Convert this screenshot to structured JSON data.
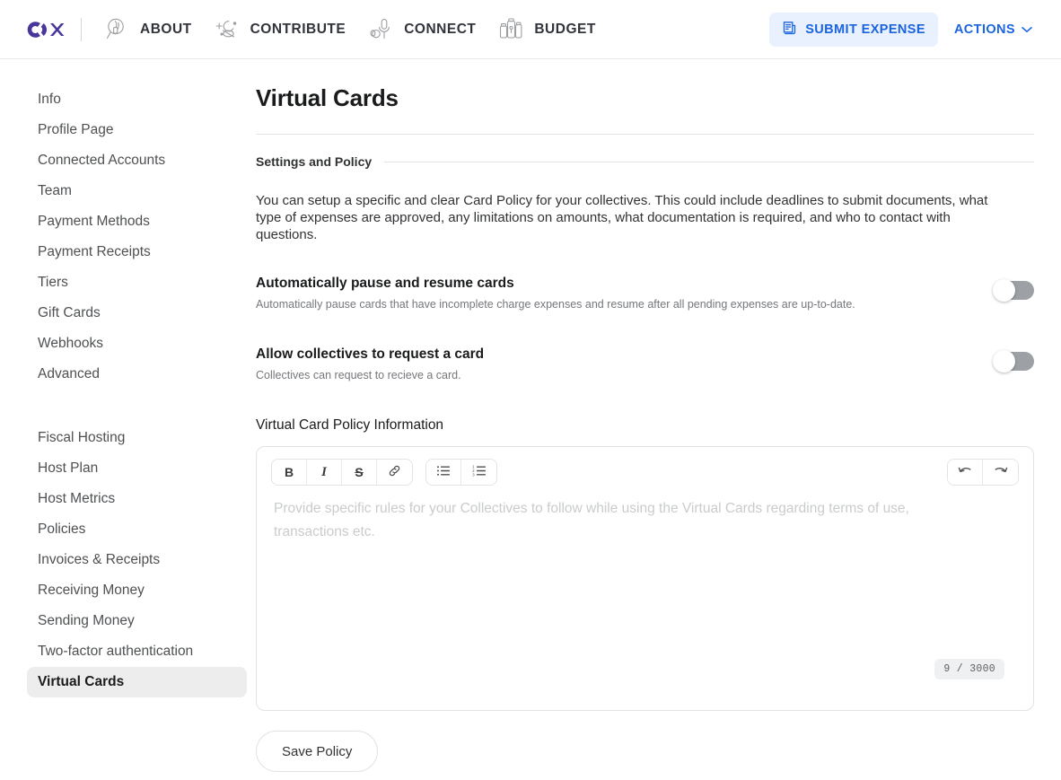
{
  "topbar": {
    "logo_name": "open-collective-logo",
    "brand_color": "#4a359a",
    "nav": [
      {
        "label": "ABOUT",
        "icon": "about-magnifier-icon"
      },
      {
        "label": "CONTRIBUTE",
        "icon": "contribute-stars-icon"
      },
      {
        "label": "CONNECT",
        "icon": "connect-microphone-icon"
      },
      {
        "label": "BUDGET",
        "icon": "budget-jars-icon"
      }
    ],
    "submit_expense": {
      "label": "SUBMIT EXPENSE",
      "icon": "receipt-icon",
      "bg_color": "#e9f1fe",
      "text_color": "#1b64e0"
    },
    "actions": {
      "label": "ACTIONS",
      "icon": "chevron-down-icon",
      "text_color": "#1b64e0"
    }
  },
  "sidebar": {
    "active_item": "Virtual Cards",
    "groups": [
      {
        "items": [
          "Info",
          "Profile Page",
          "Connected Accounts",
          "Team",
          "Payment Methods",
          "Payment Receipts",
          "Tiers",
          "Gift Cards",
          "Webhooks",
          "Advanced"
        ]
      },
      {
        "items": [
          "Fiscal Hosting",
          "Host Plan",
          "Host Metrics",
          "Policies",
          "Invoices & Receipts",
          "Receiving Money",
          "Sending Money",
          "Two-factor authentication",
          "Virtual Cards"
        ]
      }
    ]
  },
  "main": {
    "title": "Virtual Cards",
    "section_label": "Settings and Policy",
    "intro": "You can setup a specific and clear Card Policy for your collectives. This could include deadlines to submit documents, what type of expenses are approved, any limitations on amounts, what documentation is required, and who to contact with questions.",
    "toggles": [
      {
        "title": "Automatically pause and resume cards",
        "description": "Automatically pause cards that have incomplete charge expenses and resume after all pending expenses are up-to-date.",
        "state": "off"
      },
      {
        "title": "Allow collectives to request a card",
        "description": "Collectives can request to recieve a card.",
        "state": "off"
      }
    ],
    "editor": {
      "label": "Virtual Card Policy Information",
      "placeholder": "Provide specific rules for your Collectives to follow while using the Virtual Cards regarding terms of use, transactions etc.",
      "value": "",
      "char_counter": "9 / 3000",
      "toolbar": {
        "format_group": [
          {
            "name": "bold-button",
            "glyph": "B"
          },
          {
            "name": "italic-button",
            "glyph": "I"
          },
          {
            "name": "strikethrough-button",
            "glyph": "S"
          },
          {
            "name": "link-button",
            "glyph": "link-icon"
          }
        ],
        "list_group": [
          {
            "name": "bullet-list-button",
            "glyph": "bullet-list-icon"
          },
          {
            "name": "ordered-list-button",
            "glyph": "ordered-list-icon"
          }
        ],
        "history_group": [
          {
            "name": "undo-button",
            "glyph": "undo-icon"
          },
          {
            "name": "redo-button",
            "glyph": "redo-icon"
          }
        ]
      }
    },
    "save_label": "Save Policy"
  }
}
